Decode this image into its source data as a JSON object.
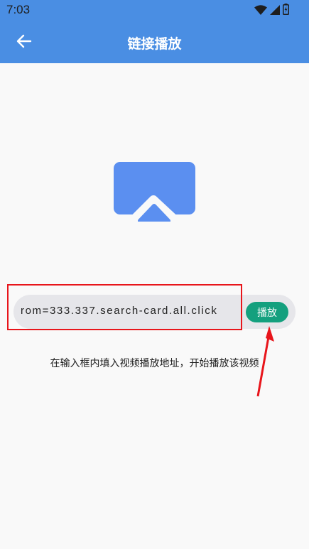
{
  "status_bar": {
    "time": "7:03",
    "icons": [
      "wifi-icon",
      "signal-icon",
      "battery-icon"
    ]
  },
  "app_bar": {
    "title": "链接播放",
    "back_icon": "arrow-left-icon",
    "background": "#4a8ee3"
  },
  "main": {
    "cast_icon": "screen-cast-icon",
    "cast_icon_color": "#5b8ff0",
    "url_input": {
      "value": "rom=333.337.search-card.all.click"
    },
    "play_button_label": "播放",
    "play_button_color": "#14a07e",
    "hint": "在输入框内填入视频播放地址，开始播放该视频"
  },
  "annotation": {
    "highlight_color": "#e8151b"
  }
}
